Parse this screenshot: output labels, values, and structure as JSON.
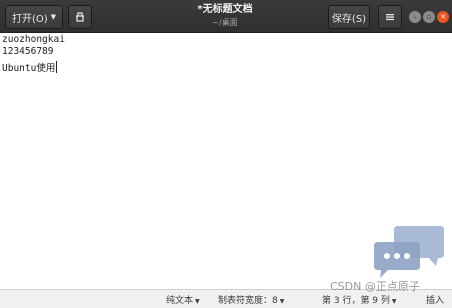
{
  "header": {
    "open_label": "打开(O)",
    "save_label": "保存(S)",
    "title": "*无标题文档",
    "subtitle": "~/桌面"
  },
  "editor": {
    "lines": [
      "zuozhongkai",
      "123456789",
      "Ubuntu使用"
    ]
  },
  "statusbar": {
    "language": "纯文本",
    "tab_width": "制表符宽度：8",
    "position": "第 3 行，第 9 列",
    "mode": "插入"
  },
  "watermark": {
    "text": "CSDN @正点原子"
  },
  "colors": {
    "header_bg": "#2f2f2f",
    "close_button": "#e95420",
    "statusbar_bg": "#f0f0f0"
  },
  "icons": [
    "caret-down-icon",
    "document-icon",
    "hamburger-menu-icon",
    "minimize-icon",
    "maximize-icon",
    "close-icon",
    "chat-bubble-icon"
  ]
}
